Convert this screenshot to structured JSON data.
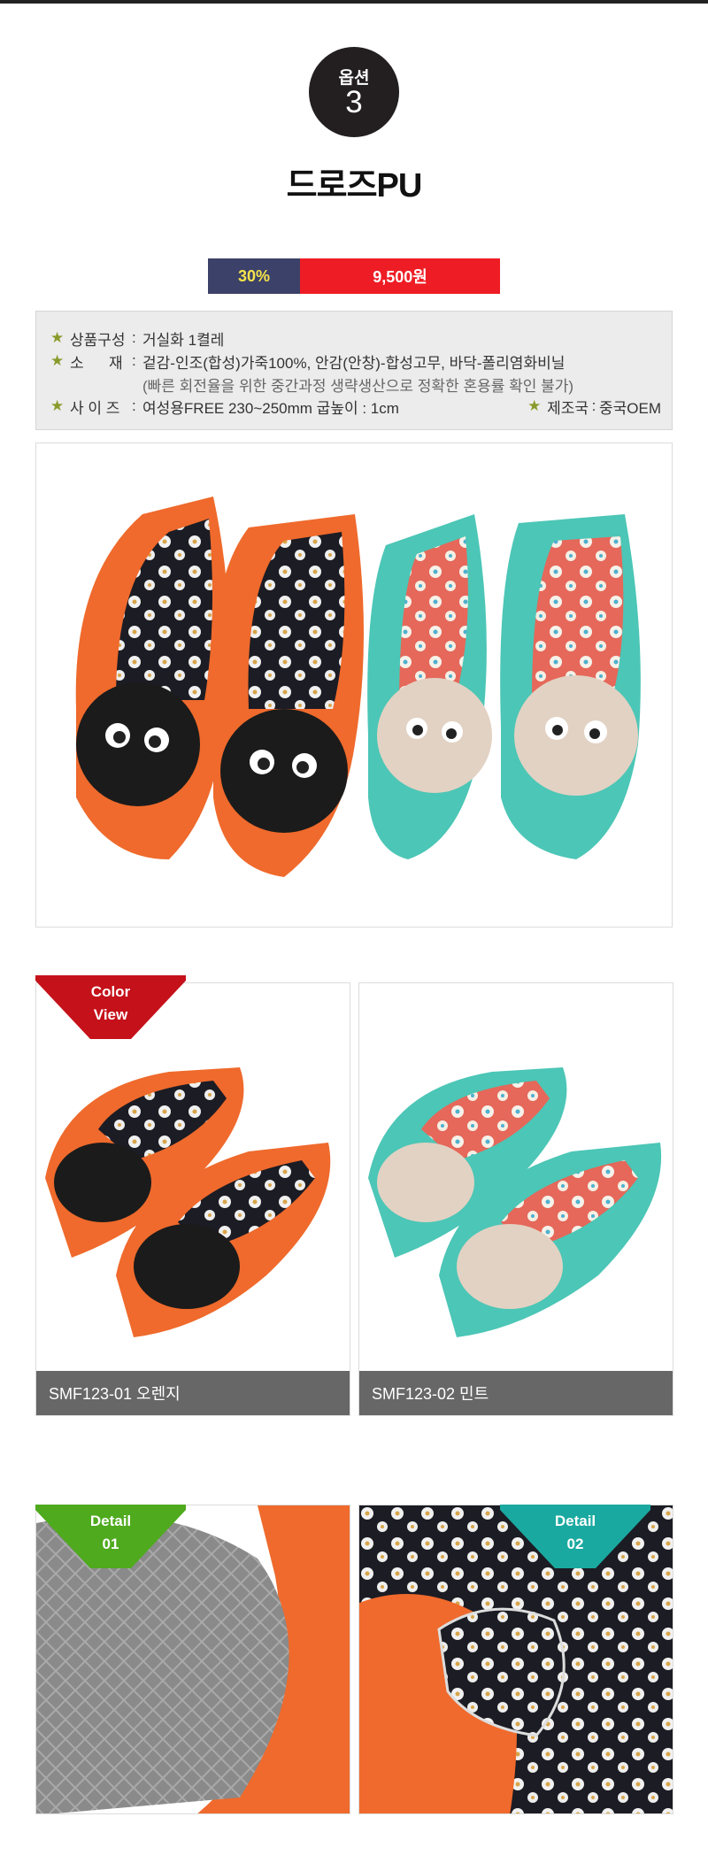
{
  "option": {
    "label": "옵션",
    "number": "3"
  },
  "product": {
    "title": "드로즈PU"
  },
  "price_bar": {
    "discount": "30%",
    "price": "9,500원"
  },
  "spec": {
    "rows": [
      {
        "key": "상품구성",
        "value": "거실화 1켤레"
      },
      {
        "key": "소      재",
        "value": "겉감-인조(합성)가죽100%, 안감(안창)-합성고무, 바닥-폴리염화비닐"
      },
      {
        "key": "사 이 즈",
        "value": "여성용FREE 230~250mm 굽높이 : 1cm"
      }
    ],
    "note": "(빠른 회전율을 위한 중간과정 생략생산으로 정확한 혼용률 확인 불가)",
    "origin": {
      "key": "제조국",
      "value": "중국OEM"
    }
  },
  "color_view": {
    "line1": "Color",
    "line2": "View"
  },
  "thumbnails": [
    {
      "caption": "SMF123-01 오렌지"
    },
    {
      "caption": "SMF123-02 민트"
    }
  ],
  "details": [
    {
      "line1": "Detail",
      "line2": "01"
    },
    {
      "line1": "Detail",
      "line2": "02"
    }
  ],
  "colors": {
    "dark_circle": "#231f20",
    "discount_bg": "#3b4168",
    "discount_text": "#f6e34a",
    "price_bg": "#ee1c24",
    "color_ribbon": "#c5111a",
    "detail01_ribbon": "#4faa1e",
    "detail02_ribbon": "#1aa9a0",
    "orange": "#ef6a2c",
    "mint": "#4cc6b6"
  }
}
